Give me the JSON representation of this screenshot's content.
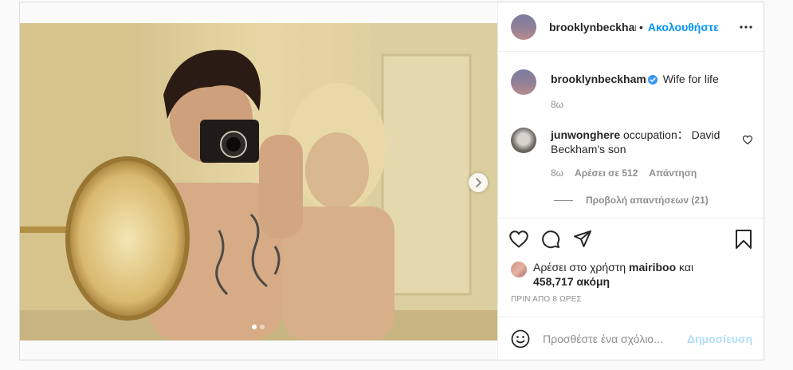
{
  "post_header": {
    "username": "brooklynbeckham",
    "separator": "•",
    "follow_label": "Ακολουθήστε"
  },
  "caption": {
    "username": "brooklynbeckham",
    "text": "Wife for life",
    "age": "8ω"
  },
  "comments": [
    {
      "username": "junwonghere",
      "text": "occupation： David Beckham's son",
      "age": "8ω",
      "likes": "Αρέσει σε 512",
      "reply_label": "Απάντηση",
      "view_replies": "Προβολή απαντήσεων (21)"
    }
  ],
  "likes": {
    "prefix": "Αρέσει στο χρήστη ",
    "user": "mairiboo",
    "connector": " και",
    "count": "458,717 ακόμη"
  },
  "timestamp": "ΠΡΙΝ ΑΠΟ 8 ΩΡΕΣ",
  "add_comment": {
    "placeholder": "Προσθέστε ένα σχόλιο...",
    "post_label": "Δημοσίευση"
  },
  "carousel": {
    "total": 2,
    "current": 1
  },
  "icons": [
    "more-options-icon",
    "verified-badge-icon",
    "heart-icon",
    "comment-icon",
    "share-icon",
    "bookmark-icon",
    "emoji-icon",
    "chevron-right-icon"
  ],
  "colors": {
    "accent": "#0095f6",
    "accent_disabled": "#b2dffc",
    "verified": "#3897f0",
    "muted": "#8e8e8e"
  }
}
